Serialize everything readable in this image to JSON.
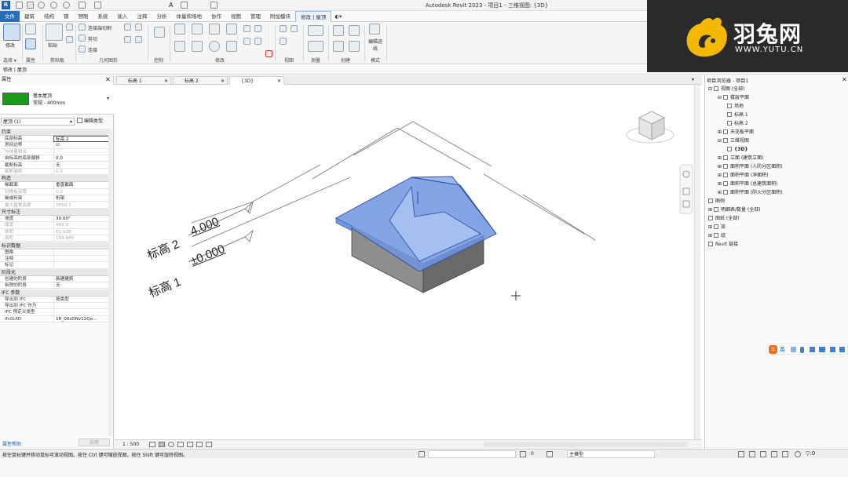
{
  "app": {
    "title": "Autodesk Revit 2023 - 项目1 - 三维视图: {3D}"
  },
  "ribbon_tabs": [
    "文件",
    "建筑",
    "结构",
    "钢",
    "预制",
    "系统",
    "插入",
    "注释",
    "分析",
    "体量和场地",
    "协作",
    "视图",
    "管理",
    "附加模块",
    "修改 | 屋顶"
  ],
  "ribbon": {
    "select_button": "修改",
    "select_dropdown": "选择 ▾",
    "paste_button": "粘贴",
    "cut": "剪切",
    "join": "连接",
    "join_cut": "连接端切割",
    "groups": [
      "属性",
      "剪贴板",
      "几何图形",
      "控制",
      "修改",
      "视图",
      "测量",
      "创建",
      "模式"
    ],
    "edit_footprint": "编辑迹线"
  },
  "context_bar": {
    "label": "修改 | 屋顶"
  },
  "properties": {
    "title": "属性",
    "type_name": "基本屋顶",
    "type_sub": "常规 - 400mm",
    "type_color": "#1a9a1a",
    "instance_selector": "屋顶 (1)",
    "edit_type": "编辑类型",
    "sections": [
      {
        "name": "约束",
        "rows": [
          {
            "k": "底部标高",
            "v": "标高 2",
            "dim": false
          },
          {
            "k": "房间边界",
            "v": "☑",
            "dim": false
          },
          {
            "k": "与体量相关",
            "v": "",
            "dim": true
          },
          {
            "k": "自标高的底部偏移",
            "v": "0.0",
            "dim": false
          },
          {
            "k": "截断标高",
            "v": "无",
            "dim": false
          },
          {
            "k": "截断偏移",
            "v": "0.0",
            "dim": true
          }
        ]
      },
      {
        "name": "构造",
        "rows": [
          {
            "k": "椽截面",
            "v": "垂直截面",
            "dim": false
          },
          {
            "k": "封檐板深度",
            "v": "0.0",
            "dim": true
          },
          {
            "k": "椽或桁架",
            "v": "桁架",
            "dim": false
          },
          {
            "k": "最大屋脊高度",
            "v": "7550.7",
            "dim": true
          }
        ]
      },
      {
        "name": "尺寸标注",
        "rows": [
          {
            "k": "坡度",
            "v": "30.00°",
            "dim": false
          },
          {
            "k": "厚度",
            "v": "400.0",
            "dim": true
          },
          {
            "k": "体积",
            "v": "63.938",
            "dim": true
          },
          {
            "k": "面积",
            "v": "159.845",
            "dim": true
          }
        ]
      },
      {
        "name": "标识数据",
        "rows": [
          {
            "k": "图像",
            "v": "",
            "dim": false
          },
          {
            "k": "注释",
            "v": "",
            "dim": false
          },
          {
            "k": "标记",
            "v": "",
            "dim": false
          }
        ]
      },
      {
        "name": "阶段化",
        "rows": [
          {
            "k": "创建的阶段",
            "v": "新建建筑",
            "dim": false
          },
          {
            "k": "拆除的阶段",
            "v": "无",
            "dim": false
          }
        ]
      },
      {
        "name": "IFC 参数",
        "rows": [
          {
            "k": "导出到 IFC",
            "v": "按类型",
            "dim": false
          },
          {
            "k": "导出到 IFC 作为",
            "v": "",
            "dim": false
          },
          {
            "k": "IFC 预定义类型",
            "v": "",
            "dim": false
          },
          {
            "k": "IfcGUID",
            "v": "1R_00sDNv12Qo...",
            "dim": false
          }
        ]
      }
    ],
    "help_link": "属性帮助",
    "apply_button": "应用"
  },
  "view_tabs": [
    "标高 1",
    "标高 2",
    "{3D}"
  ],
  "viewport": {
    "level2_name": "标高 2",
    "level2_value": "4.000",
    "level1_name": "标高 1",
    "level1_value": "±0.000",
    "roof_color": "#6f95e0"
  },
  "view_bar": {
    "scale": "1 : 500"
  },
  "project_browser": {
    "title": "项目浏览器 - 项目1",
    "items": [
      {
        "label": "视图 (全部)",
        "indent": 0,
        "expander": "⊟"
      },
      {
        "label": "楼层平面",
        "indent": 1,
        "expander": "⊟"
      },
      {
        "label": "场地",
        "indent": 2,
        "expander": ""
      },
      {
        "label": "标高 1",
        "indent": 2,
        "expander": ""
      },
      {
        "label": "标高 2",
        "indent": 2,
        "expander": ""
      },
      {
        "label": "天花板平面",
        "indent": 1,
        "expander": "⊞"
      },
      {
        "label": "三维视图",
        "indent": 1,
        "expander": "⊟"
      },
      {
        "label": "{3D}",
        "indent": 2,
        "expander": ""
      },
      {
        "label": "立面 (建筑立面)",
        "indent": 1,
        "expander": "⊞"
      },
      {
        "label": "面积平面 (人防分区面积)",
        "indent": 1,
        "expander": "⊞"
      },
      {
        "label": "面积平面 (净面积)",
        "indent": 1,
        "expander": "⊞"
      },
      {
        "label": "面积平面 (总建筑面积)",
        "indent": 1,
        "expander": "⊞"
      },
      {
        "label": "面积平面 (防火分区面积)",
        "indent": 1,
        "expander": "⊞"
      },
      {
        "label": "图例",
        "indent": 0,
        "expander": ""
      },
      {
        "label": "明细表/数量 (全部)",
        "indent": 0,
        "expander": "⊞"
      },
      {
        "label": "图纸 (全部)",
        "indent": 0,
        "expander": ""
      },
      {
        "label": "族",
        "indent": 0,
        "expander": "⊞"
      },
      {
        "label": "组",
        "indent": 0,
        "expander": "⊞"
      },
      {
        "label": "Revit 链接",
        "indent": 0,
        "expander": ""
      }
    ]
  },
  "status_bar": {
    "message": "按住鼠标键并移动鼠标可滚动视图。按住 Ctrl 键可缩放视图。按住 Shift 键可旋转视图。",
    "model": "主模型",
    "filter_count": "0"
  },
  "ime": {
    "label": "英"
  },
  "logo": {
    "brand": "羽兔网",
    "url": "WWW.YUTU.CN",
    "accent": "#f5b800"
  }
}
